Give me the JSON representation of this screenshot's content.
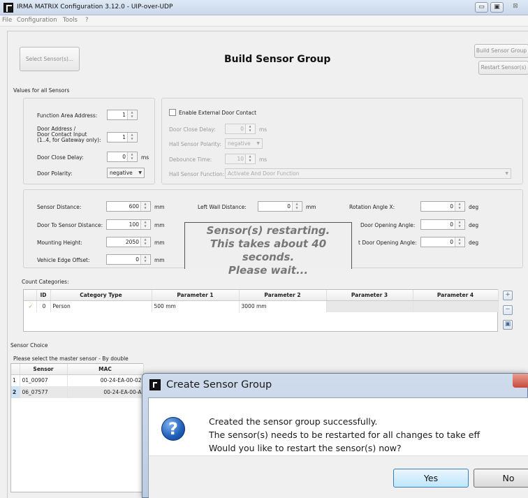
{
  "window": {
    "title": "IRMA MATRIX Configuration 3.12.0  -  UIP-over-UDP",
    "controls": {
      "minimize": "▭",
      "maximize": "▣",
      "close": "⊠"
    }
  },
  "menu": [
    "File",
    "Configuration",
    "Tools",
    "?"
  ],
  "toolbar": {
    "select_sensors": "Select Sensor(s)...",
    "heading": "Build Sensor Group",
    "build_sensor_group": "Build Sensor Group",
    "restart_sensors": "Restart Sensor(s)"
  },
  "values_group": {
    "title": "Values for all Sensors",
    "function_area_address": {
      "label": "Function Area Address:",
      "value": "1"
    },
    "door_address": {
      "label_lines": [
        "Door Address /",
        "Door Contact Input",
        "(1..4, for Gateway only):"
      ],
      "value": "1"
    },
    "door_close_delay": {
      "label": "Door Close Delay:",
      "value": "0",
      "unit": "ms"
    },
    "door_polarity": {
      "label": "Door Polarity:",
      "value": "negative"
    },
    "external": {
      "checkbox_label": "Enable External Door Contact",
      "close_delay": {
        "label": "Door Close Delay:",
        "value": "0",
        "unit": "ms"
      },
      "hall_polarity": {
        "label": "Hall Sensor Polarity:",
        "value": "negative"
      },
      "debounce": {
        "label": "Debounce Time:",
        "value": "10",
        "unit": "ms"
      },
      "hall_function": {
        "label": "Hall Sensor Function:",
        "value": "Activate And Door Function"
      }
    }
  },
  "geometry_group": {
    "sensor_distance": {
      "label": "Sensor Distance:",
      "value": "600",
      "unit": "mm"
    },
    "door_to_sensor": {
      "label": "Door To Sensor Distance:",
      "value": "100",
      "unit": "mm"
    },
    "mounting_height": {
      "label": "Mounting Height:",
      "value": "2050",
      "unit": "mm"
    },
    "vehicle_edge": {
      "label": "Vehicle Edge Offset:",
      "value": "0",
      "unit": "mm"
    },
    "left_wall": {
      "label": "Left Wall Distance:",
      "value": "0",
      "unit": "mm"
    },
    "rotation_x": {
      "label": "Rotation Angle X:",
      "value": "0",
      "unit": "deg"
    },
    "door_opening_angle": {
      "label": "Door Opening Angle:",
      "value": "0",
      "unit": "deg"
    },
    "t_door_opening_angle": {
      "label": "t Door Opening Angle:",
      "value": "0",
      "unit": "deg"
    },
    "overlay_lines": [
      "Sensor(s) restarting.",
      "This takes about 40 seconds.",
      "Please wait..."
    ]
  },
  "count_categories": {
    "title": "Count Categories:",
    "columns": [
      "ID",
      "Category Type",
      "Parameter 1",
      "Parameter 2",
      "Parameter 3",
      "Parameter 4"
    ],
    "rows": [
      {
        "check": "✓",
        "id": "0",
        "type": "Person",
        "p1": "500 mm",
        "p2": "3000 mm",
        "p3": "",
        "p4": ""
      }
    ],
    "side_buttons": {
      "add": "+",
      "remove": "−",
      "save": "▣"
    }
  },
  "sensor_choice": {
    "title": "Sensor Choice",
    "instruction": "Please select the master sensor - By double",
    "columns": [
      "Sensor",
      "MAC"
    ],
    "rows": [
      {
        "num": "1",
        "sensor": "01_00907",
        "mac": "00-24-EA-00-02"
      },
      {
        "num": "2",
        "sensor": "06_07577",
        "mac": "00-24-EA-00-A"
      }
    ]
  },
  "dialog": {
    "title": "Create Sensor Group",
    "icon": "?",
    "lines": [
      "Created the sensor group successfully.",
      "The sensor(s) needs to be restarted for all changes to take eff",
      "Would you like to restart the sensor(s) now?"
    ],
    "yes": "Yes",
    "no": "No"
  },
  "colors": {
    "dialog_close": "#c8483c",
    "selection": "#cfe3f7",
    "check": "#6fbf3a"
  }
}
